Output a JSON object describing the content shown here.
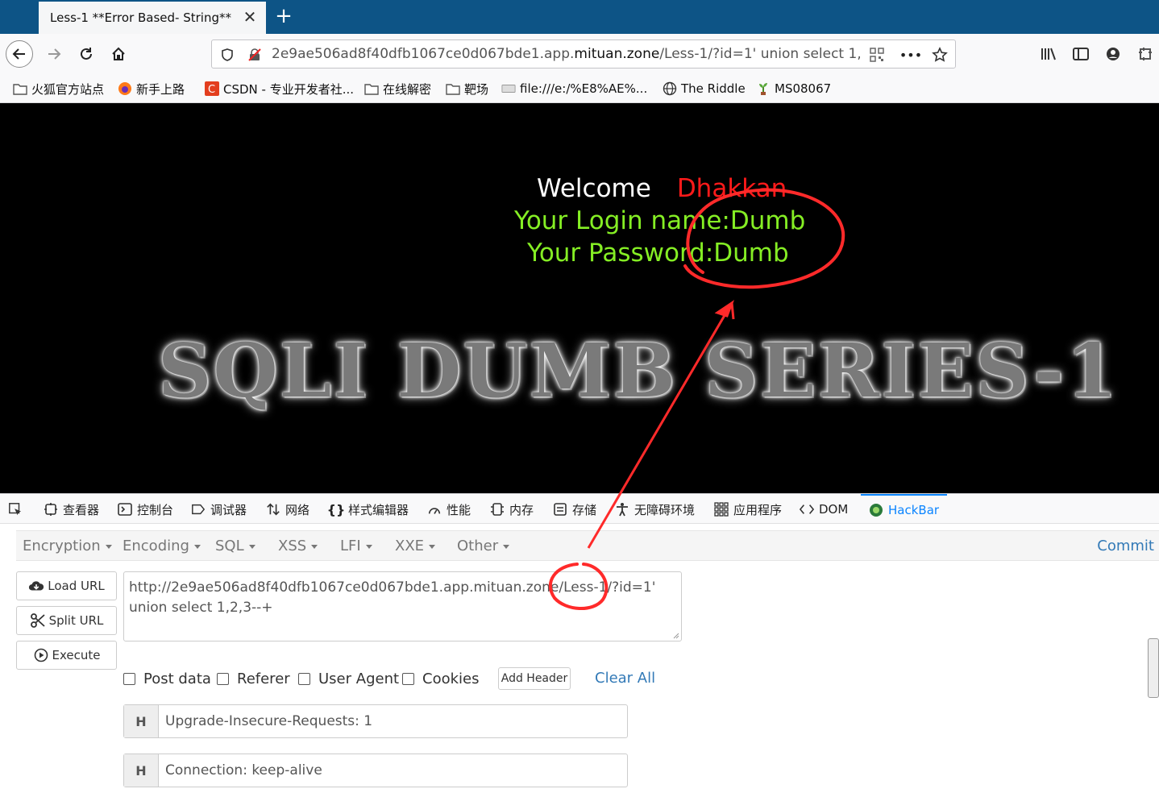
{
  "browser": {
    "tab_title": "Less-1 **Error Based- String**",
    "tab_close": "✕",
    "new_tab": "+",
    "url_prefix": "2e9ae506ad8f40dfb1067ce0d067bde1.app.",
    "url_host": "mituan.zone",
    "url_suffix": "/Less-1/?id=1' union select 1,2,3--+",
    "url_more": "•••"
  },
  "bookmarks": [
    {
      "label": "火狐官方站点",
      "icon": "folder-icon"
    },
    {
      "label": "新手上路",
      "icon": "firefox-icon"
    },
    {
      "label": "CSDN - 专业开发者社...",
      "icon": "csdn-icon"
    },
    {
      "label": "在线解密",
      "icon": "folder-icon"
    },
    {
      "label": "靶场",
      "icon": "folder-icon"
    },
    {
      "label": "file:///e:/%E8%AE%...",
      "icon": "file-icon"
    },
    {
      "label": "The Riddle",
      "icon": "globe-icon"
    },
    {
      "label": "MS08067",
      "icon": "plant-icon"
    }
  ],
  "page": {
    "welcome": "Welcome",
    "name": "Dhakkan",
    "login": "Your Login name:Dumb",
    "password": "Your Password:Dumb",
    "banner": "SQLI DUMB SERIES-1"
  },
  "devtools": {
    "tabs": [
      "查看器",
      "控制台",
      "调试器",
      "网络",
      "样式编辑器",
      "性能",
      "内存",
      "存储",
      "无障碍环境",
      "应用程序",
      "DOM",
      "HackBar"
    ]
  },
  "hackbar": {
    "menus": [
      "Encryption",
      "Encoding",
      "SQL",
      "XSS",
      "LFI",
      "XXE",
      "Other"
    ],
    "commit": "Commit",
    "load_url": "Load URL",
    "split_url": "Split URL",
    "execute": "Execute",
    "url_value": "http://2e9ae506ad8f40dfb1067ce0d067bde1.app.mituan.zone/Less-1/?id=1' union select 1,2,3--+",
    "checkboxes": [
      "Post data",
      "Referer",
      "User Agent",
      "Cookies"
    ],
    "add_header": "Add Header",
    "clear_all": "Clear All",
    "headers": [
      {
        "badge": "H",
        "value": "Upgrade-Insecure-Requests: 1"
      },
      {
        "badge": "H",
        "value": "Connection: keep-alive"
      }
    ]
  },
  "colors": {
    "tab_strip": "#0d5486",
    "accent": "#0a84ff",
    "login_green": "#85ee24",
    "name_red": "#ff1a1a",
    "annotation_red": "#ff2a2a"
  }
}
